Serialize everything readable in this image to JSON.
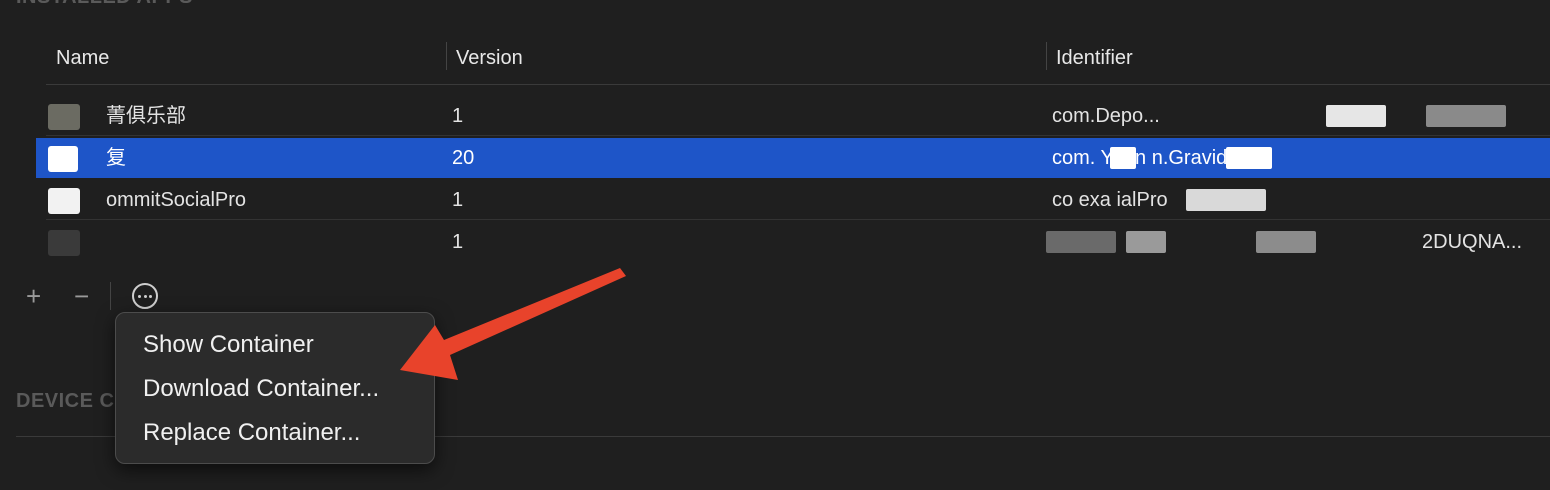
{
  "sections": {
    "installed_apps": "INSTALLED APPS",
    "device": "DEVICE C"
  },
  "table": {
    "columns": [
      "Name",
      "Version",
      "Identifier"
    ],
    "rows": [
      {
        "name": "菁俱乐部",
        "version": "1",
        "identifier": "com.Depo...",
        "selected": false
      },
      {
        "name": "复",
        "version": "20",
        "identifier": "com.    Yuan   n.Gravida",
        "selected": true
      },
      {
        "name": "ommitSocialPro",
        "version": "1",
        "identifier": "co   exa   ialPro",
        "selected": false
      },
      {
        "name": "",
        "version": "1",
        "identifier": "2DUQNA...",
        "selected": false
      }
    ]
  },
  "toolbar": {
    "add": "+",
    "remove": "−"
  },
  "menu": {
    "items": [
      "Show Container",
      "Download Container...",
      "Replace Container..."
    ]
  },
  "colors": {
    "selection": "#1e55c8",
    "arrow": "#e8432b",
    "background": "#1f1f1f"
  },
  "icons": [
    "more-icon",
    "app-icon",
    "arrow-annotation"
  ]
}
